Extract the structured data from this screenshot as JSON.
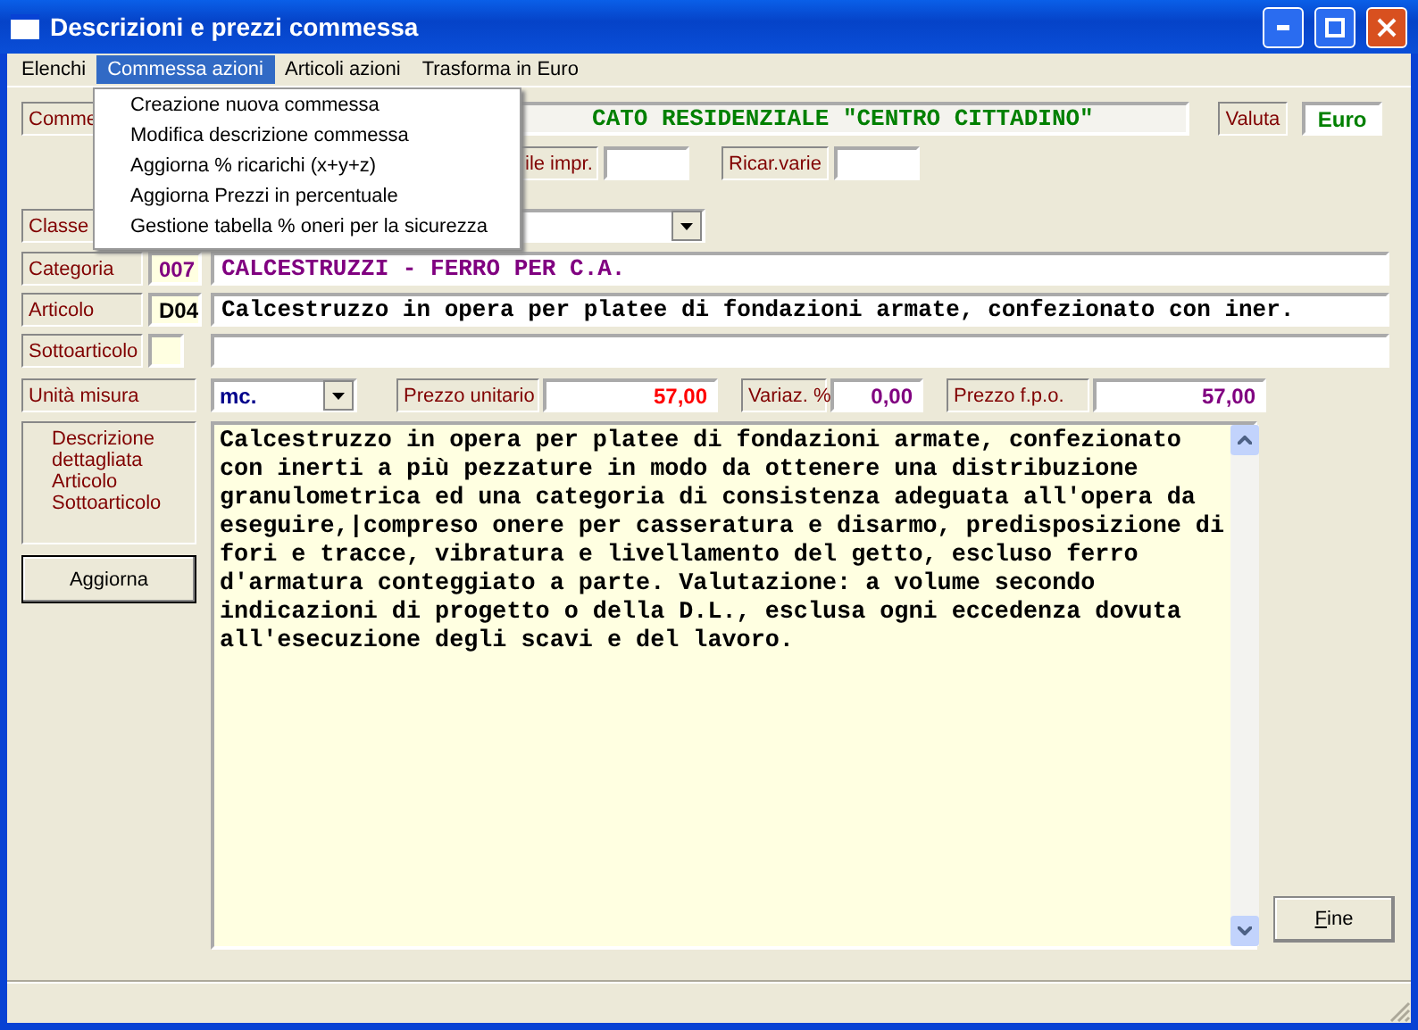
{
  "window": {
    "title": "Descrizioni e prezzi commessa"
  },
  "menu": [
    {
      "label": "Elenchi",
      "selected": false
    },
    {
      "label": "Commessa azioni",
      "selected": true
    },
    {
      "label": "Articoli azioni",
      "selected": false
    },
    {
      "label": "Trasforma in Euro",
      "selected": false
    }
  ],
  "open_menu": {
    "items": [
      "Creazione nuova commessa",
      "Modifica descrizione commessa",
      "Aggiorna % ricarichi (x+y+z)",
      "Aggiorna Prezzi in percentuale",
      "Gestione tabella % oneri per la sicurezza"
    ]
  },
  "commessa": {
    "label": "Comme",
    "value": "CATO RESIDENZIALE \"CENTRO CITTADINO\""
  },
  "valuta": {
    "label": "Valuta",
    "value": "Euro"
  },
  "ricarichi": [
    {
      "label": "ile impr."
    },
    {
      "label": "Ricar.varie"
    }
  ],
  "classe": {
    "label": "Classe"
  },
  "categoria": {
    "label": "Categoria",
    "code": "007",
    "value": "CALCESTRUZZI - FERRO PER C.A."
  },
  "articolo": {
    "label": "Articolo",
    "code": "D04",
    "value": "Calcestruzzo in opera per platee di fondazioni armate, confezionato con iner."
  },
  "sottoarticolo": {
    "label": "Sottoarticolo"
  },
  "unita": {
    "label": "Unità misura",
    "value": "mc."
  },
  "prezzi": [
    {
      "label": "Prezzo unitario",
      "value": "57,00",
      "color": "#ff0000"
    },
    {
      "label": "Variaz. %",
      "value": "0,00",
      "color": "#800080"
    },
    {
      "label": "Prezzo f.p.o.",
      "value": "57,00",
      "color": "#800080"
    }
  ],
  "descrizione": {
    "label_lines": [
      "Descrizione",
      "dettagliata",
      "Articolo",
      "Sottoarticolo"
    ],
    "lines": [
      "Calcestruzzo in opera per platee di fondazioni armate, confezionato",
      "con inerti a più pezzature in modo da ottenere una distribuzione",
      "granulometrica ed una categoria di consistenza adeguata all'opera da",
      "eseguire,|compreso onere per casseratura e disarmo, predisposizione di",
      "fori e tracce, vibratura e livellamento del getto, escluso ferro",
      "d'armatura conteggiato a parte. Valutazione: a volume secondo",
      "indicazioni di progetto o della D.L., esclusa ogni eccedenza dovuta",
      "all'esecuzione degli scavi e del lavoro."
    ]
  },
  "buttons": {
    "aggiorna": "Aggiorna",
    "fine": "Fine"
  }
}
